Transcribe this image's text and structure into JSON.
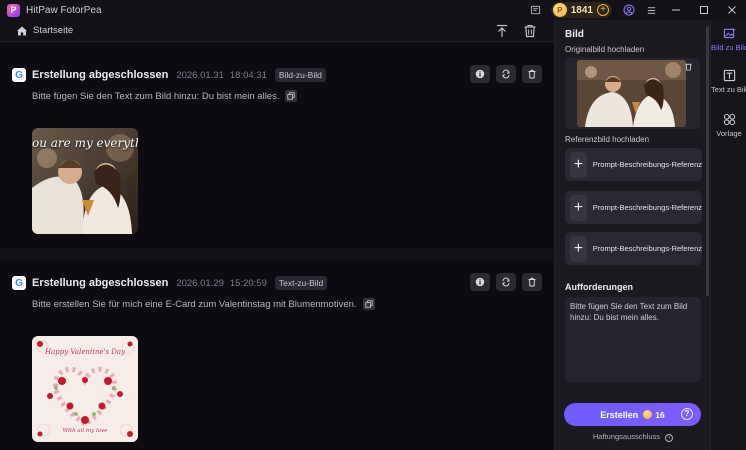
{
  "app": {
    "title": "HitPaw FotorPea",
    "logo_letter": "P"
  },
  "titlebar": {
    "coin_count": "1841"
  },
  "toolbar": {
    "home_label": "Startseite"
  },
  "cards": [
    {
      "title": "Erstellung abgeschlossen",
      "date": "2026.01.31",
      "time": "18:04:31",
      "tag": "Bild-zu-Bild",
      "prompt": "Bitte fügen Sie den Text zum Bild hinzu: Du bist mein alles.",
      "image_text": "ou are my everythin"
    },
    {
      "title": "Erstellung abgeschlossen",
      "date": "2026.01.29",
      "time": "15:20:59",
      "tag": "Text-zu-Bild",
      "prompt": "Bitte erstellen Sie für mich eine E-Card zum Valentinstag mit Blumenmotiven.",
      "image_text_top": "Happy Valentine's Day",
      "image_text_bottom": "With all my love"
    }
  ],
  "panel": {
    "title": "Bild",
    "original_label": "Originalbild hochladen",
    "reference_label": "Referenzbild hochladen",
    "references": [
      "Prompt-Beschreibungs-Referenz",
      "Prompt-Beschreibungs-Referenz",
      "Prompt-Beschreibungs-Referenz"
    ],
    "prompt_label": "Aufforderungen",
    "prompt_value": "Bitte fügen Sie den Text zum Bild hinzu: Du bist mein alles.",
    "create_label": "Erstellen",
    "create_cost": "16",
    "disclaimer": "Haftungsausschluss"
  },
  "rail": [
    {
      "label": "Bild zu Bild",
      "active": true
    },
    {
      "label": "Text zu Bild",
      "active": false
    },
    {
      "label": "Vorlage",
      "active": false
    }
  ],
  "colors": {
    "accent": "#7e5bff",
    "coin": "#f2a93b"
  }
}
